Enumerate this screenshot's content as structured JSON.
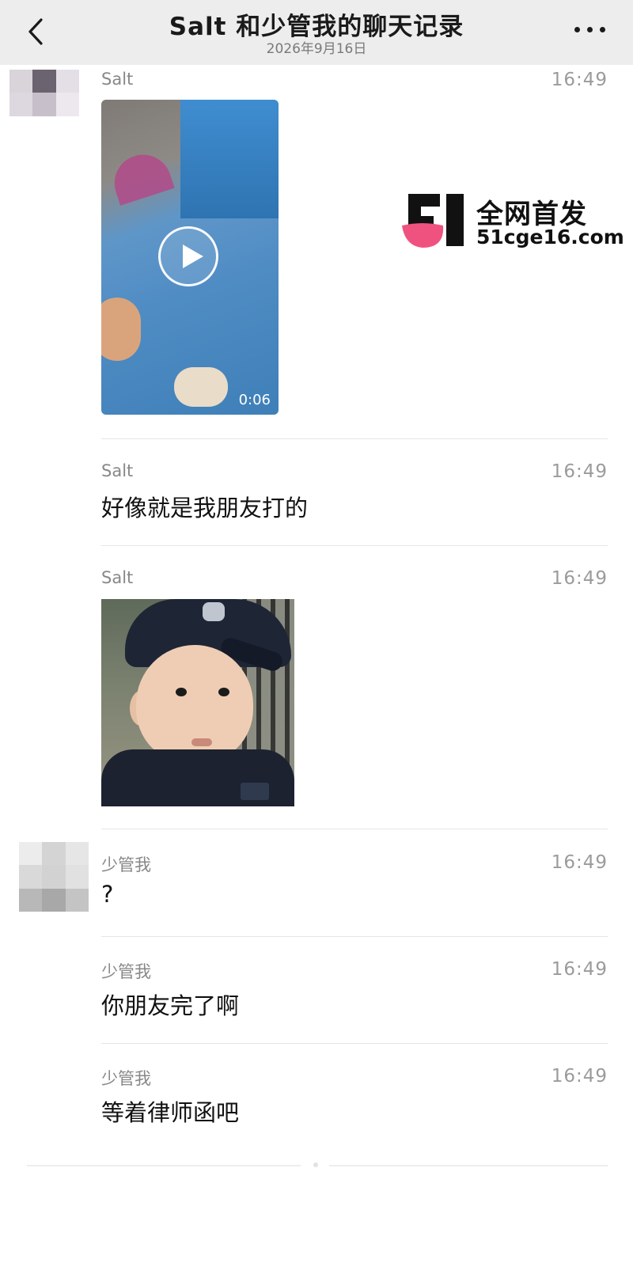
{
  "header": {
    "title": "Salt 和少管我的聊天记录",
    "date": "2026年9月16日"
  },
  "colors": {
    "header_bg": "#ededed",
    "text": "#111111",
    "meta": "#9b9b9b",
    "watermark_accent": "#f0527f"
  },
  "messages": [
    {
      "sender": "Salt",
      "time": "16:49",
      "type": "video",
      "duration": "0:06"
    },
    {
      "sender": "Salt",
      "time": "16:49",
      "type": "text",
      "text": "好像就是我朋友打的"
    },
    {
      "sender": "Salt",
      "time": "16:49",
      "type": "sticker"
    },
    {
      "sender": "少管我",
      "time": "16:49",
      "type": "text",
      "text": "?"
    },
    {
      "sender": "少管我",
      "time": "16:49",
      "type": "text",
      "text": "你朋友完了啊"
    },
    {
      "sender": "少管我",
      "time": "16:49",
      "type": "text",
      "text": "等着律师函吧"
    }
  ],
  "watermark": {
    "title": "全网首发",
    "url": "51cge16.com"
  },
  "icons": {
    "back": "chevron-left-icon",
    "more": "ellipsis-icon",
    "play": "play-icon"
  }
}
